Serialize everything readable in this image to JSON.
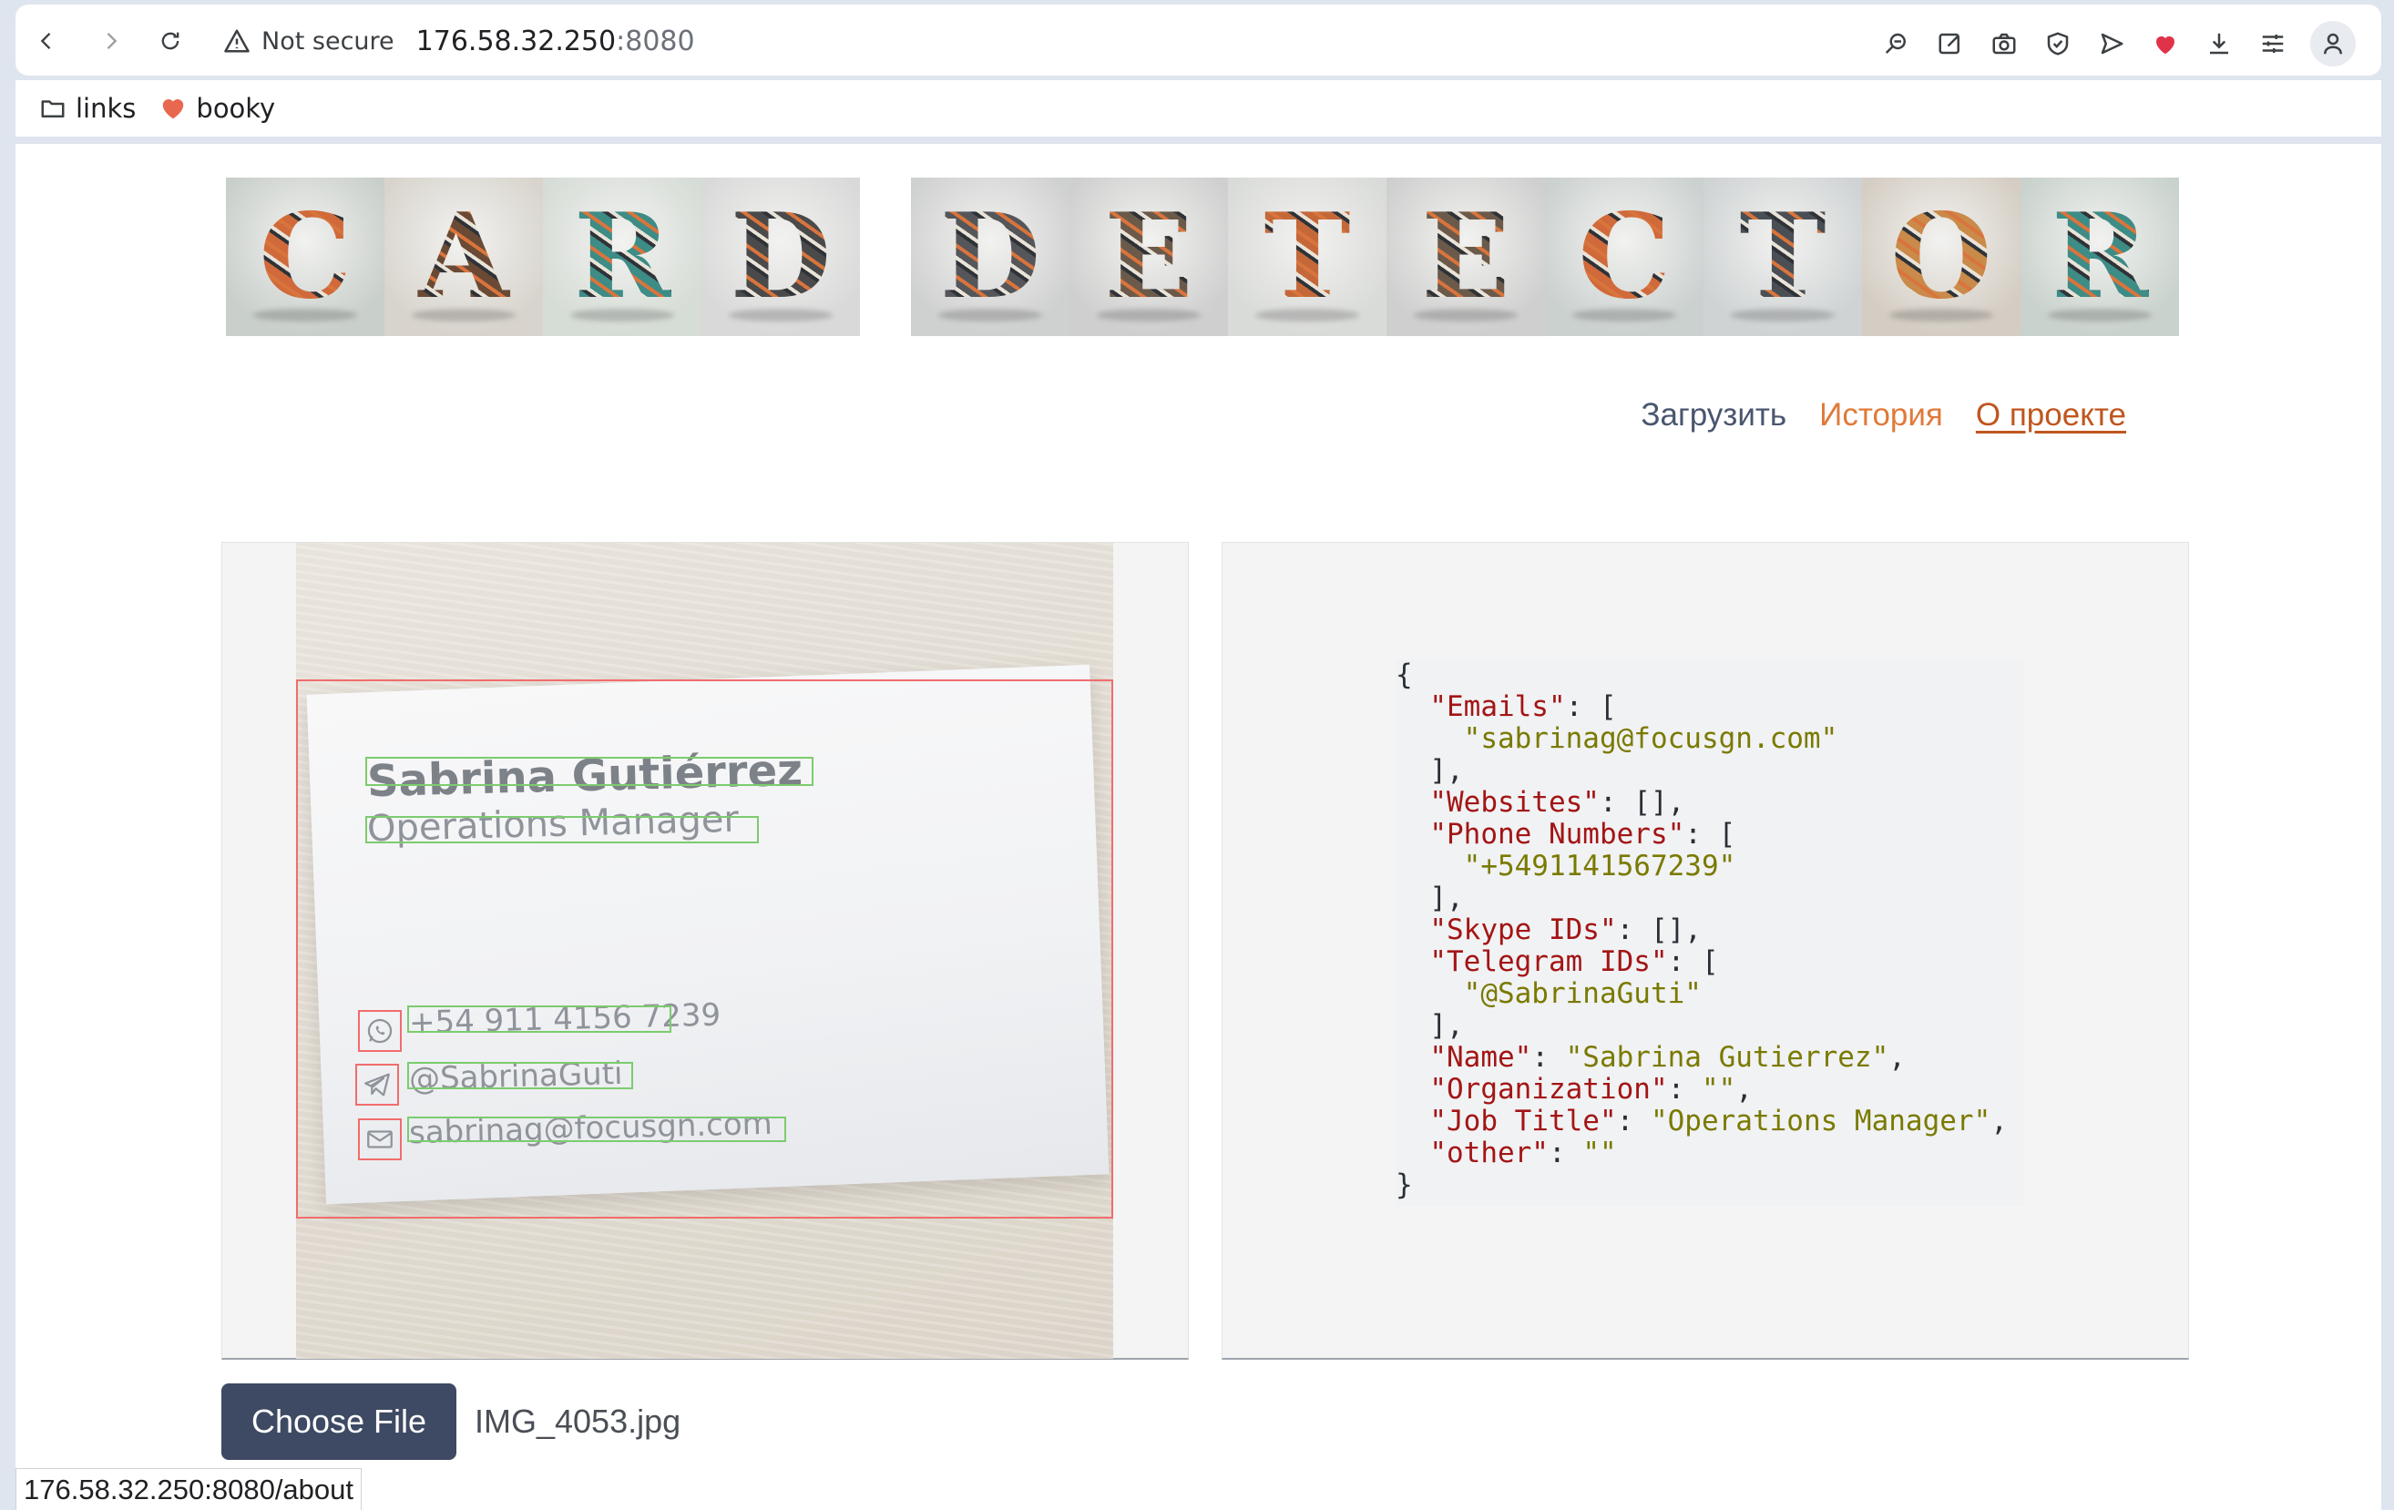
{
  "browser": {
    "security_label": "Not secure",
    "host": "176.58.32.250",
    "port": ":8080",
    "bookmarks": [
      {
        "label": "links",
        "icon": "folder-icon"
      },
      {
        "label": "booky",
        "icon": "heart-icon"
      }
    ],
    "status_url": "176.58.32.250:8080/about"
  },
  "logo": {
    "word1": [
      "C",
      "A",
      "R",
      "D"
    ],
    "word2": [
      "D",
      "E",
      "T",
      "E",
      "C",
      "T",
      "O",
      "R"
    ],
    "tile_colors": [
      "#c9cfcb",
      "#d8d4cd",
      "#d6dcd6",
      "#d9d9d9",
      "#cfd0d0",
      "#cfcfcf",
      "#d9dbd9",
      "#cfcfcf",
      "#cbd1cf",
      "#cfd3d4",
      "#d4cdc3",
      "#c9d2cd"
    ],
    "letter_colors": [
      "#d06a3a",
      "#6b4a35",
      "#3d8c86",
      "#4a4a4a",
      "#55565a",
      "#6b5a4a",
      "#c4683a",
      "#6b5a4a",
      "#d06a3a",
      "#4a4f55",
      "#c98a4a",
      "#3d8c86"
    ]
  },
  "menu": {
    "upload": "Загрузить",
    "history": "История",
    "about": "О проекте"
  },
  "card": {
    "name": "Sabrina Gutiérrez",
    "role": "Operations Manager",
    "phone": "+54 911 4156 7239",
    "telegram": "@SabrinaGuti",
    "email": "sabrinag@focusgn.com"
  },
  "result": {
    "Emails": [
      "sabrinag@focusgn.com"
    ],
    "Websites": [],
    "Phone Numbers": [
      "+5491141567239"
    ],
    "Skype IDs": [],
    "Telegram IDs": [
      "@SabrinaGuti"
    ],
    "Name": "Sabrina Gutierrez",
    "Organization": "",
    "Job Title": "Operations Manager",
    "other": ""
  },
  "file": {
    "button_label": "Choose File",
    "filename": "IMG_4053.jpg"
  }
}
